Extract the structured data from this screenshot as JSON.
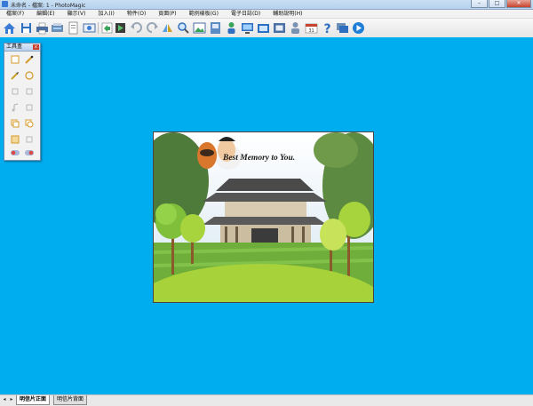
{
  "window": {
    "title": "未命名 - 檔案: 1 - PhotoMagic",
    "controls": {
      "minimize": "–",
      "maximize": "□",
      "close": "✕"
    }
  },
  "menu": [
    "檔案(F)",
    "編輯(E)",
    "顯示(V)",
    "加入(I)",
    "物件(O)",
    "頁面(P)",
    "範例樣板(G)",
    "電子日誌(D)",
    "輔助說明(H)"
  ],
  "toolbar_icons": [
    "home-icon",
    "save-icon",
    "print-icon",
    "scan-icon",
    "print-preview-icon",
    "view-icon",
    "import-icon",
    "export-icon",
    "undo-icon",
    "redo-icon",
    "flip-icon",
    "zoom-icon",
    "photo-icon",
    "album-icon",
    "person-icon",
    "monitor-icon",
    "gallery-icon",
    "frame-icon",
    "upload-icon",
    "user-icon",
    "calendar-icon",
    "help-icon",
    "screen-icon",
    "play-icon"
  ],
  "toolbox": {
    "title": "工具盒",
    "close": "x",
    "tools": [
      "new-page-icon",
      "pen-icon",
      "brush-icon",
      "circle-icon",
      "crop-icon",
      "align-icon",
      "music-icon",
      "resize-icon",
      "copy-icon",
      "layer-icon",
      "frame-tool-icon",
      "grid-icon",
      "toggle-icon",
      "color-icon"
    ]
  },
  "card": {
    "caption": "Best Memory to You.",
    "colors": {
      "sky": "#d6e6f2",
      "grass": "#6fae3a",
      "mound": "#a8d23a",
      "temple_roof": "#565656"
    }
  },
  "tabs": {
    "active": "明信片正面",
    "inactive": "明信片背面"
  },
  "nav": {
    "prev": "◂",
    "next": "▸"
  },
  "colors": {
    "workspace": "#00adef",
    "accent": "#3a7bd5"
  }
}
